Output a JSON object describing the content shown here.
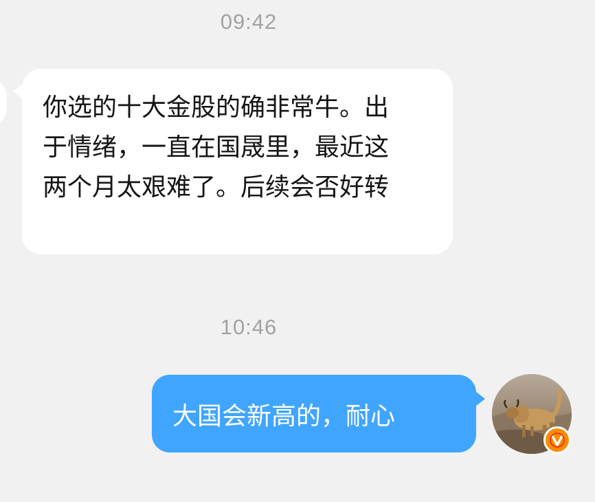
{
  "chat": {
    "timestamps": [
      "09:42",
      "10:46"
    ],
    "messages": [
      {
        "side": "incoming",
        "text": "你选的十大金股的确非常牛。出于情绪，一直在国晟里，最近这两个月太艰难了。后续会否好转"
      },
      {
        "side": "outgoing",
        "text": "大国会新高的，耐心"
      }
    ]
  },
  "icons": {
    "avatar": "yak-avatar",
    "badge": "verified-v-icon"
  },
  "colors": {
    "background": "#f1f1f1",
    "incoming_bubble": "#ffffff",
    "outgoing_bubble": "#40a5ff",
    "timestamp": "#a2a2a2",
    "badge": "#ff8a00"
  }
}
